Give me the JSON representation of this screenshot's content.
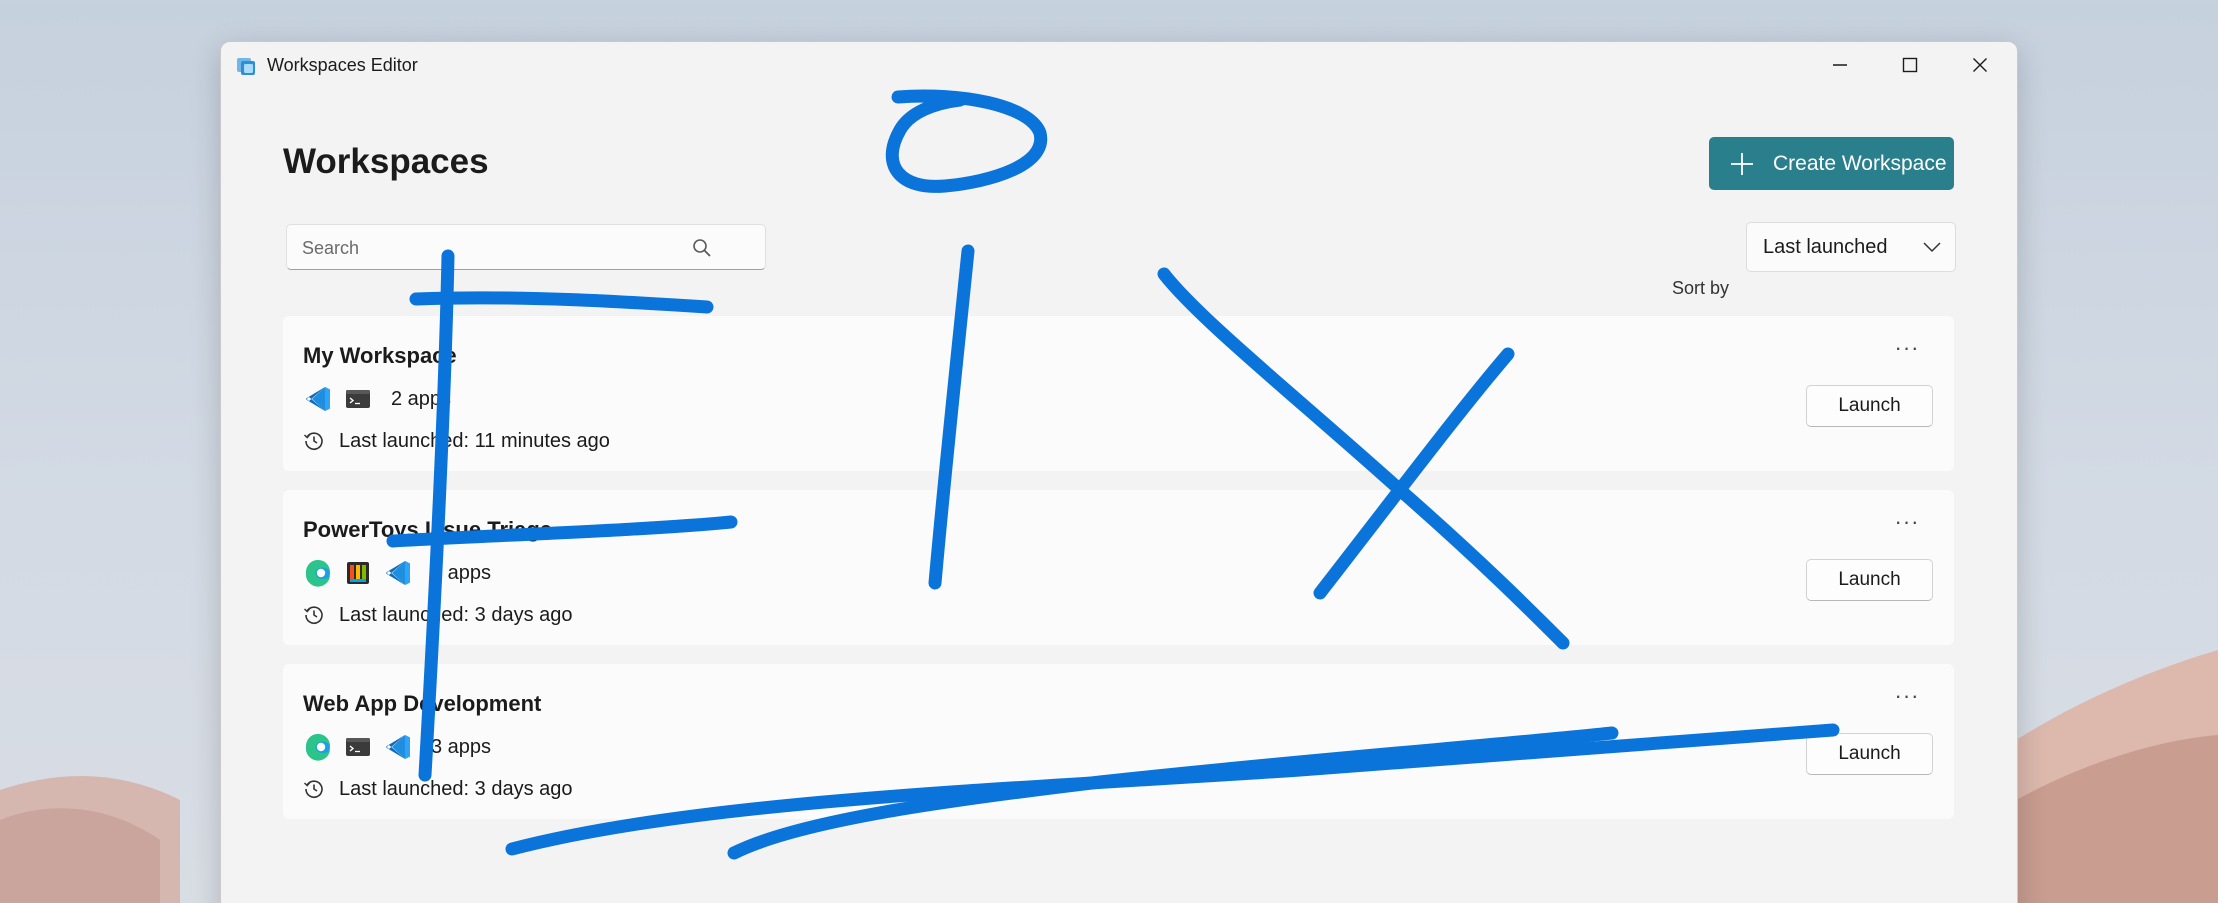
{
  "window": {
    "title": "Workspaces Editor",
    "controls": [
      "minimize-icon",
      "maximize-icon",
      "close-icon"
    ]
  },
  "header": {
    "title": "Workspaces",
    "create_label": "Create Workspace"
  },
  "search": {
    "placeholder": "Search",
    "value": ""
  },
  "sort": {
    "label": "Sort by",
    "selected": "Last launched"
  },
  "workspaces": [
    {
      "name": "My Workspace",
      "apps": [
        "vscode-icon",
        "terminal-icon"
      ],
      "app_count": "2 apps",
      "last_launched": "Last launched: 11 minutes ago",
      "launch_label": "Launch",
      "more_label": "···"
    },
    {
      "name": "PowerToys Issue Triage",
      "apps": [
        "edge-icon",
        "powertoys-icon",
        "vscode-icon"
      ],
      "app_count": "3 apps",
      "last_launched": "Last launched: 3 days ago",
      "launch_label": "Launch",
      "more_label": "···"
    },
    {
      "name": "Web App Development",
      "apps": [
        "edge-icon",
        "terminal-icon",
        "vscode-icon"
      ],
      "app_count": "3 apps",
      "last_launched": "Last launched: 3 days ago",
      "launch_label": "Launch",
      "more_label": "···"
    }
  ],
  "colors": {
    "accent": "#2a7f8c",
    "ink": "#0a74da",
    "window_bg": "#f3f3f3",
    "card_bg": "#fbfbfb"
  }
}
